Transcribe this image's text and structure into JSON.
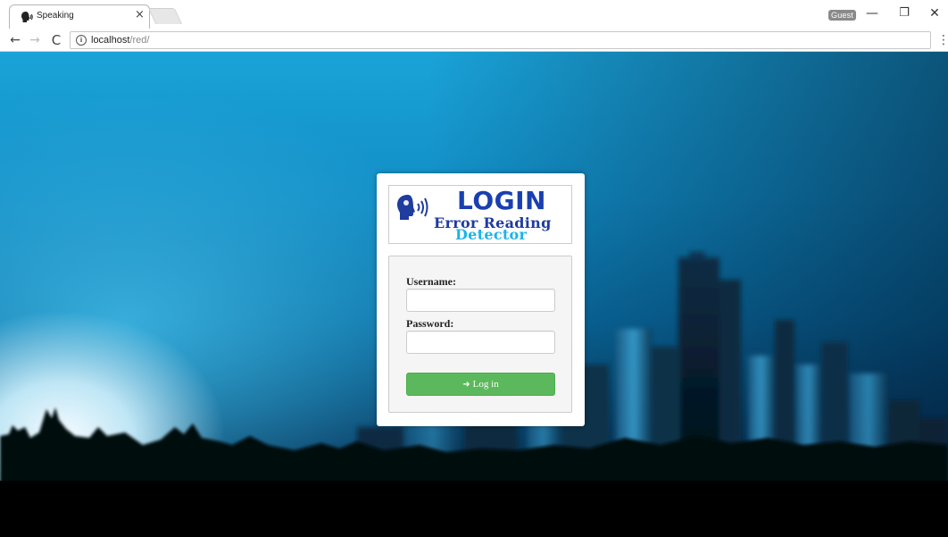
{
  "browser": {
    "tab_title": "Speaking",
    "tab_close": "×",
    "profile_label": "Guest",
    "window_min": "—",
    "window_restore": "❐",
    "window_close": "✕",
    "nav_back": "←",
    "nav_forward": "→",
    "nav_reload": "C",
    "info_icon": "i",
    "url_host": "localhost",
    "url_path": "/red/",
    "menu": "⋮"
  },
  "login_card": {
    "logo": {
      "heading": "LOGIN",
      "line1": "Error Reading",
      "line2": "Detector"
    },
    "form": {
      "username_label": "Username:",
      "username_value": "",
      "password_label": "Password:",
      "password_value": "",
      "submit_icon": "➜",
      "submit_label": "Log in"
    }
  },
  "colors": {
    "button_green": "#5cb85c",
    "logo_dark_blue": "#1f3c9e",
    "logo_light_blue": "#1db4e6",
    "background_sky": "#1aa3d8"
  }
}
